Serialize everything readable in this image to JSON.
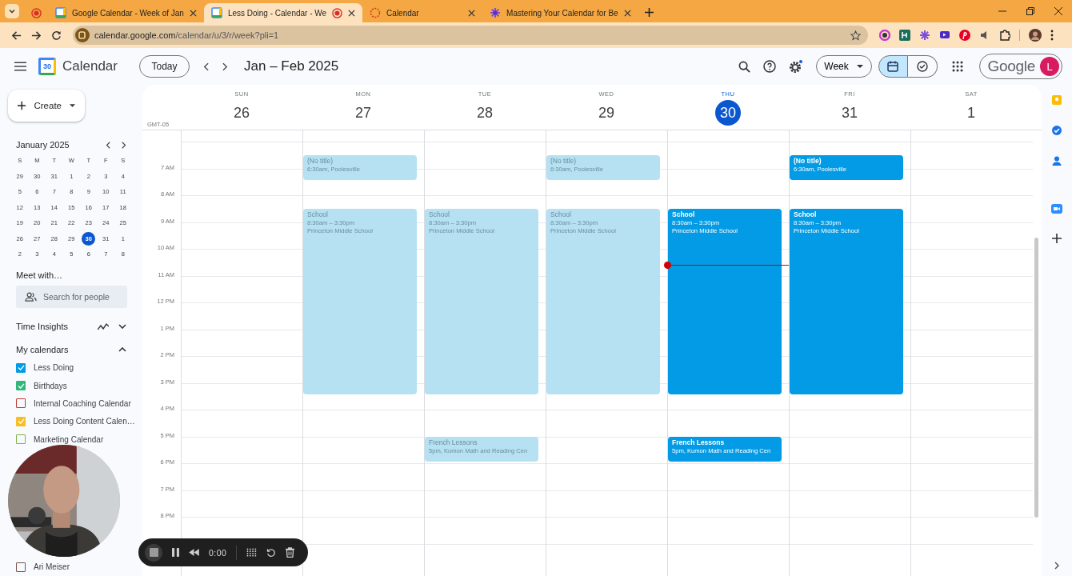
{
  "browser": {
    "tabs": [
      {
        "kind": "pinned",
        "selected": false,
        "recording": false
      },
      {
        "kind": "calendar",
        "title": "Google Calendar - Week of Jan",
        "selected": false,
        "recording": false
      },
      {
        "kind": "calendar",
        "title": "Less Doing - Calendar - We",
        "selected": true,
        "recording": true
      },
      {
        "kind": "loading",
        "title": "Calendar",
        "selected": false,
        "recording": false
      },
      {
        "kind": "flower",
        "title": "Mastering Your Calendar for Be",
        "selected": false,
        "recording": false
      }
    ],
    "url_host": "calendar.google.com",
    "url_path": "/calendar/u/3/r/week?pli=1"
  },
  "header": {
    "logo_day": "30",
    "app_name": "Calendar",
    "today_button": "Today",
    "range_title": "Jan – Feb 2025",
    "view_select": "Week",
    "view_toggle": [
      {
        "kind": "calendar",
        "selected": true
      },
      {
        "kind": "tasks",
        "selected": false
      }
    ],
    "brand": "Google",
    "avatar": "L"
  },
  "sidebar": {
    "create_button": "Create",
    "mini_calendar": {
      "title": "January 2025",
      "weekdays": [
        "S",
        "M",
        "T",
        "W",
        "T",
        "F",
        "S"
      ],
      "weeks": [
        [
          {
            "day": "29",
            "selected": false
          },
          {
            "day": "30",
            "selected": false
          },
          {
            "day": "31",
            "selected": false
          },
          {
            "day": "1",
            "selected": false
          },
          {
            "day": "2",
            "selected": false
          },
          {
            "day": "3",
            "selected": false
          },
          {
            "day": "4",
            "selected": false
          }
        ],
        [
          {
            "day": "5",
            "selected": false
          },
          {
            "day": "6",
            "selected": false
          },
          {
            "day": "7",
            "selected": false
          },
          {
            "day": "8",
            "selected": false
          },
          {
            "day": "9",
            "selected": false
          },
          {
            "day": "10",
            "selected": false
          },
          {
            "day": "11",
            "selected": false
          }
        ],
        [
          {
            "day": "12",
            "selected": false
          },
          {
            "day": "13",
            "selected": false
          },
          {
            "day": "14",
            "selected": false
          },
          {
            "day": "15",
            "selected": false
          },
          {
            "day": "16",
            "selected": false
          },
          {
            "day": "17",
            "selected": false
          },
          {
            "day": "18",
            "selected": false
          }
        ],
        [
          {
            "day": "19",
            "selected": false
          },
          {
            "day": "20",
            "selected": false
          },
          {
            "day": "21",
            "selected": false
          },
          {
            "day": "22",
            "selected": false
          },
          {
            "day": "23",
            "selected": false
          },
          {
            "day": "24",
            "selected": false
          },
          {
            "day": "25",
            "selected": false
          }
        ],
        [
          {
            "day": "26",
            "selected": false
          },
          {
            "day": "27",
            "selected": false
          },
          {
            "day": "28",
            "selected": false
          },
          {
            "day": "29",
            "selected": false
          },
          {
            "day": "30",
            "selected": true
          },
          {
            "day": "31",
            "selected": false
          },
          {
            "day": "1",
            "selected": false
          }
        ],
        [
          {
            "day": "2",
            "selected": false
          },
          {
            "day": "3",
            "selected": false
          },
          {
            "day": "4",
            "selected": false
          },
          {
            "day": "5",
            "selected": false
          },
          {
            "day": "6",
            "selected": false
          },
          {
            "day": "7",
            "selected": false
          },
          {
            "day": "8",
            "selected": false
          }
        ]
      ]
    },
    "meet_title": "Meet with…",
    "people_search": {
      "placeholder": "Search for people"
    },
    "time_insights": "Time Insights",
    "my_calendars": "My calendars",
    "calendars": [
      {
        "name": "Less Doing",
        "checked": true,
        "color": "#039be5"
      },
      {
        "name": "Birthdays",
        "checked": true,
        "color": "#33b679"
      },
      {
        "name": "Internal Coaching Calendar",
        "checked": false,
        "color": "#c0392b"
      },
      {
        "name": "Less Doing Content Calen…",
        "checked": true,
        "color": "#f6bf26"
      },
      {
        "name": "Marketing Calendar",
        "checked": false,
        "color": "#7cb342"
      }
    ],
    "bottom_calendars": [
      {
        "name": "Ari Meiser",
        "checked": false,
        "color": "#795548"
      }
    ]
  },
  "grid": {
    "timezone": "GMT-05",
    "hours": [
      "7 AM",
      "8 AM",
      "9 AM",
      "10 AM",
      "11 AM",
      "12 PM",
      "1 PM",
      "2 PM",
      "3 PM",
      "4 PM",
      "5 PM",
      "6 PM",
      "7 PM",
      "8 PM"
    ],
    "days": [
      {
        "weekday": "SUN",
        "date": "26",
        "selected": false
      },
      {
        "weekday": "MON",
        "date": "27",
        "selected": false,
        "events": [
          {
            "kind": "early",
            "title": "(No title)",
            "details": [
              "6:30am, Poolesville"
            ],
            "past": true
          },
          {
            "kind": "school",
            "title": "School",
            "details": [
              "8:30am – 3:30pm",
              "Princeton Middle School"
            ],
            "past": true
          }
        ]
      },
      {
        "weekday": "TUE",
        "date": "28",
        "selected": false,
        "events": [
          {
            "kind": "school",
            "title": "School",
            "details": [
              "8:30am – 3:30pm",
              "Princeton Middle School"
            ],
            "past": true
          },
          {
            "kind": "lesson",
            "title": "French Lessons",
            "details": [
              "5pm, Kumon Math and Reading Cen"
            ],
            "past": true
          }
        ]
      },
      {
        "weekday": "WED",
        "date": "29",
        "selected": false,
        "events": [
          {
            "kind": "early",
            "title": "(No title)",
            "details": [
              "6:30am, Poolesville"
            ],
            "past": true
          },
          {
            "kind": "school",
            "title": "School",
            "details": [
              "8:30am – 3:30pm",
              "Princeton Middle School"
            ],
            "past": true
          }
        ]
      },
      {
        "weekday": "THU",
        "date": "30",
        "selected": true,
        "events": [
          {
            "kind": "school",
            "title": "School",
            "details": [
              "8:30am – 3:30pm",
              "Princeton Middle School"
            ],
            "past": false
          },
          {
            "kind": "lesson",
            "title": "French Lessons",
            "details": [
              "5pm, Kumon Math and Reading Cen"
            ],
            "past": false
          }
        ]
      },
      {
        "weekday": "FRI",
        "date": "31",
        "selected": false,
        "events": [
          {
            "kind": "early",
            "title": "(No title)",
            "details": [
              "6:30am, Poolesville"
            ],
            "past": false
          },
          {
            "kind": "school",
            "title": "School",
            "details": [
              "8:30am – 3:30pm",
              "Princeton Middle School"
            ],
            "past": false
          }
        ]
      },
      {
        "weekday": "SAT",
        "date": "1",
        "selected": false
      }
    ]
  },
  "recorder": {
    "time": "0:00"
  }
}
